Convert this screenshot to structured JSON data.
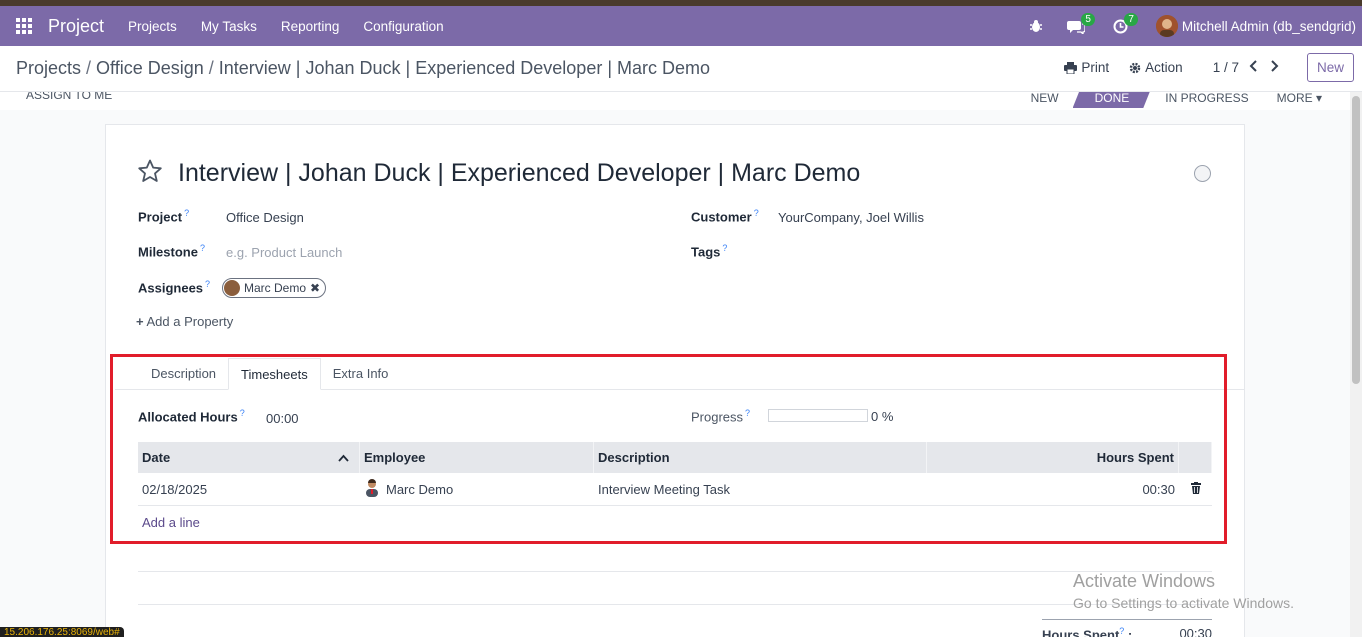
{
  "navbar": {
    "brand": "Project",
    "menu": [
      "Projects",
      "My Tasks",
      "Reporting",
      "Configuration"
    ],
    "chat_count": "5",
    "activity_count": "7",
    "user": "Mitchell Admin (db_sendgrid)"
  },
  "breadcrumb": [
    "Projects",
    "Office Design",
    "Interview | Johan Duck | Experienced Developer | Marc Demo"
  ],
  "control": {
    "print": "Print",
    "action": "Action",
    "pager": "1 / 7",
    "new": "New"
  },
  "status": {
    "assign_me": "ASSIGN TO ME",
    "stages": [
      "NEW",
      "DONE",
      "IN PROGRESS",
      "MORE"
    ],
    "active_stage": "DONE"
  },
  "task": {
    "title": "Interview | Johan Duck | Experienced Developer | Marc Demo",
    "project_label": "Project",
    "project_value": "Office Design",
    "milestone_label": "Milestone",
    "milestone_placeholder": "e.g. Product Launch",
    "assignees_label": "Assignees",
    "assignee": "Marc Demo",
    "customer_label": "Customer",
    "customer_value": "YourCompany, Joel Willis",
    "tags_label": "Tags",
    "add_property": "Add a Property"
  },
  "tabs": [
    "Description",
    "Timesheets",
    "Extra Info"
  ],
  "timesheets": {
    "allocated_label": "Allocated Hours",
    "allocated_value": "00:00",
    "progress_label": "Progress",
    "progress_value": "0 %",
    "progress_fraction": 0,
    "columns": [
      "Date",
      "Employee",
      "Description",
      "Hours Spent"
    ],
    "rows": [
      {
        "date": "02/18/2025",
        "employee": "Marc Demo",
        "description": "Interview Meeting Task",
        "hours": "00:30"
      }
    ],
    "add_line": "Add a line",
    "summary_label": "Hours Spent",
    "summary_value": "00:30"
  },
  "watermark": {
    "line1": "Activate Windows",
    "line2": "Go to Settings to activate Windows."
  },
  "statusurl": "15.206.176.25:8069/web#"
}
